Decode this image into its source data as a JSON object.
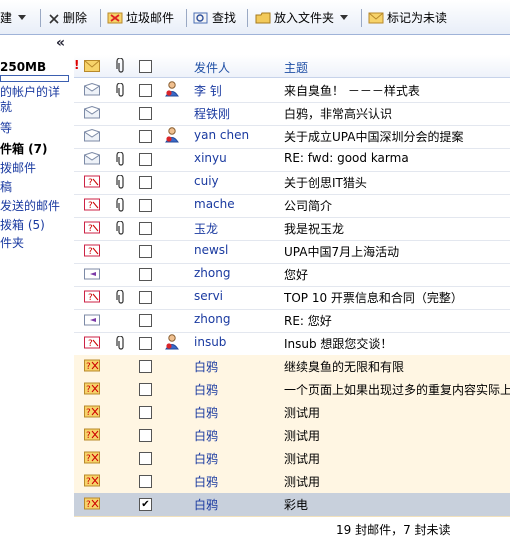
{
  "toolbar": {
    "new_label": "建",
    "delete_label": "删除",
    "spam_label": "垃圾邮件",
    "find_label": "查找",
    "move_label": "放入文件夹",
    "mark_unread_label": "标记为未读"
  },
  "sidebar": {
    "collapse_glyph": "«",
    "quota": "250MB",
    "items": [
      {
        "label": "的帐户的详"
      },
      {
        "label": "就"
      },
      {
        "label": "等"
      },
      {
        "label": "件箱 (7)"
      },
      {
        "label": "拨邮件"
      },
      {
        "label": "稿"
      },
      {
        "label": "发送的邮件"
      },
      {
        "label": "拨箱 (5)"
      },
      {
        "label": "件夹"
      }
    ]
  },
  "list": {
    "header_sender": "发件人",
    "header_subject": "主题",
    "rows": [
      {
        "sender": "李 钊",
        "subject": "来自臭鱼！ －－－样式表",
        "status": "read",
        "attach": true,
        "contact": true,
        "checked": false
      },
      {
        "sender": "程铁刚",
        "subject": "白鸦，非常高兴认识",
        "status": "read",
        "attach": false,
        "contact": false,
        "checked": false
      },
      {
        "sender": "yan chen",
        "subject": "关于成立UPA中国深圳分会的提案",
        "status": "read",
        "attach": false,
        "contact": true,
        "checked": false
      },
      {
        "sender": "xinyu",
        "subject": "RE: fwd: good karma",
        "status": "read",
        "attach": true,
        "contact": false,
        "checked": false
      },
      {
        "sender": "cuiy",
        "subject": "关于创思IT猎头",
        "status": "unknown",
        "attach": true,
        "contact": false,
        "checked": false
      },
      {
        "sender": "mache",
        "subject": "公司简介",
        "status": "unknown",
        "attach": true,
        "contact": false,
        "checked": false
      },
      {
        "sender": "玉龙",
        "subject": "我是祝玉龙",
        "status": "unknown",
        "attach": true,
        "contact": false,
        "checked": false
      },
      {
        "sender": "newsl",
        "subject": "UPA中国7月上海活动",
        "status": "unknown",
        "attach": false,
        "contact": false,
        "checked": false
      },
      {
        "sender": "zhong",
        "subject": "您好",
        "status": "replied",
        "attach": false,
        "contact": false,
        "checked": false
      },
      {
        "sender": "servi",
        "subject": "TOP 10 开票信息和合同（完整）",
        "status": "unknown",
        "attach": true,
        "contact": false,
        "checked": false
      },
      {
        "sender": "zhong",
        "subject": "RE: 您好",
        "status": "replied",
        "attach": false,
        "contact": false,
        "checked": false
      },
      {
        "sender": "insub",
        "subject": "Insub 想跟您交谈！",
        "status": "unknown",
        "attach": true,
        "contact": true,
        "checked": false
      },
      {
        "sender": "白鸦",
        "subject": "继续臭鱼的无限和有限",
        "status": "draft",
        "attach": false,
        "contact": false,
        "checked": false
      },
      {
        "sender": "白鸦",
        "subject": "一个页面上如果出现过多的重复内容实际上",
        "status": "draft",
        "attach": false,
        "contact": false,
        "checked": false
      },
      {
        "sender": "白鸦",
        "subject": "测试用",
        "status": "draft",
        "attach": false,
        "contact": false,
        "checked": false
      },
      {
        "sender": "白鸦",
        "subject": "测试用",
        "status": "draft",
        "attach": false,
        "contact": false,
        "checked": false
      },
      {
        "sender": "白鸦",
        "subject": "测试用",
        "status": "draft",
        "attach": false,
        "contact": false,
        "checked": false
      },
      {
        "sender": "白鸦",
        "subject": "测试用",
        "status": "draft",
        "attach": false,
        "contact": false,
        "checked": false
      },
      {
        "sender": "白鸦",
        "subject": "彩电",
        "status": "draft",
        "attach": false,
        "contact": false,
        "checked": true
      }
    ],
    "footer": "19 封邮件，7 封未读"
  }
}
